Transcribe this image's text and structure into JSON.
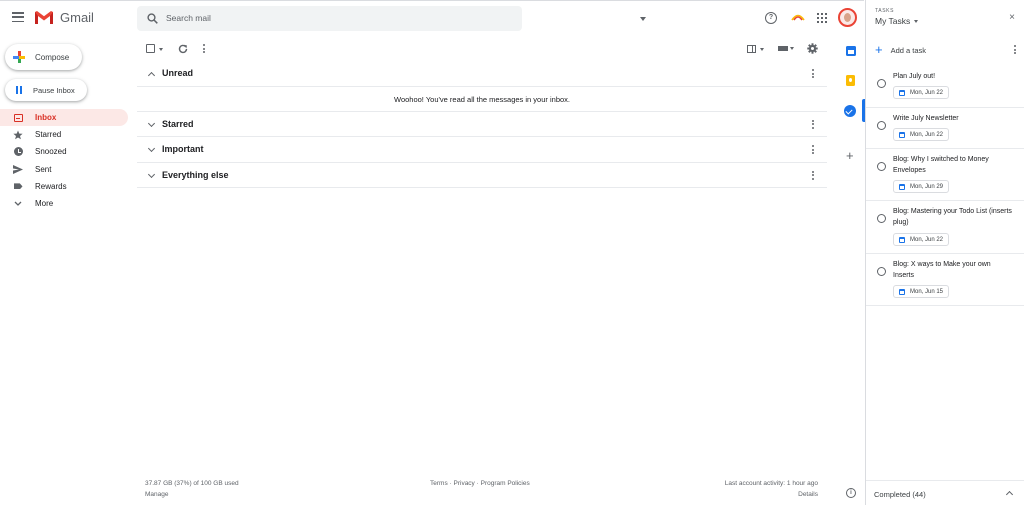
{
  "header": {
    "app_name": "Gmail",
    "search_placeholder": "Search mail",
    "help_glyph": "?"
  },
  "sidebar": {
    "compose_label": "Compose",
    "pause_label": "Pause Inbox",
    "items": [
      {
        "label": "Inbox",
        "icon": "inbox-icon",
        "active": true
      },
      {
        "label": "Starred",
        "icon": "star-icon"
      },
      {
        "label": "Snoozed",
        "icon": "clock-icon"
      },
      {
        "label": "Sent",
        "icon": "send-icon"
      },
      {
        "label": "Rewards",
        "icon": "label-icon"
      },
      {
        "label": "More",
        "icon": "chevron-down-icon"
      }
    ]
  },
  "sections": {
    "unread": "Unread",
    "empty_message": "Woohoo! You've read all the messages in your inbox.",
    "starred": "Starred",
    "important": "Important",
    "everything_else": "Everything else"
  },
  "footer": {
    "storage": "37.87 GB (37%) of 100 GB used",
    "manage": "Manage",
    "terms": "Terms",
    "privacy": "Privacy",
    "policies": "Program Policies",
    "sep": "·",
    "activity": "Last account activity: 1 hour ago",
    "details": "Details"
  },
  "tasks": {
    "kicker": "TASKS",
    "list_name": "My Tasks",
    "close_glyph": "×",
    "add_label": "Add a task",
    "items": [
      {
        "title": "Plan July out!",
        "date": "Mon, Jun 22"
      },
      {
        "title": "Write July Newsletter",
        "date": "Mon, Jun 22"
      },
      {
        "title": "Blog: Why I switched to Money Envelopes",
        "date": "Mon, Jun 29"
      },
      {
        "title": "Blog: Mastering your Todo List (inserts plug)",
        "date": "Mon, Jun 22"
      },
      {
        "title": "Blog: X ways to Make your own Inserts",
        "date": "Mon, Jun 15"
      }
    ],
    "completed_label": "Completed (44)"
  },
  "colors": {
    "gmail_red": "#d93025",
    "accent_blue": "#1a73e8",
    "active_bg": "#fce8e6"
  }
}
